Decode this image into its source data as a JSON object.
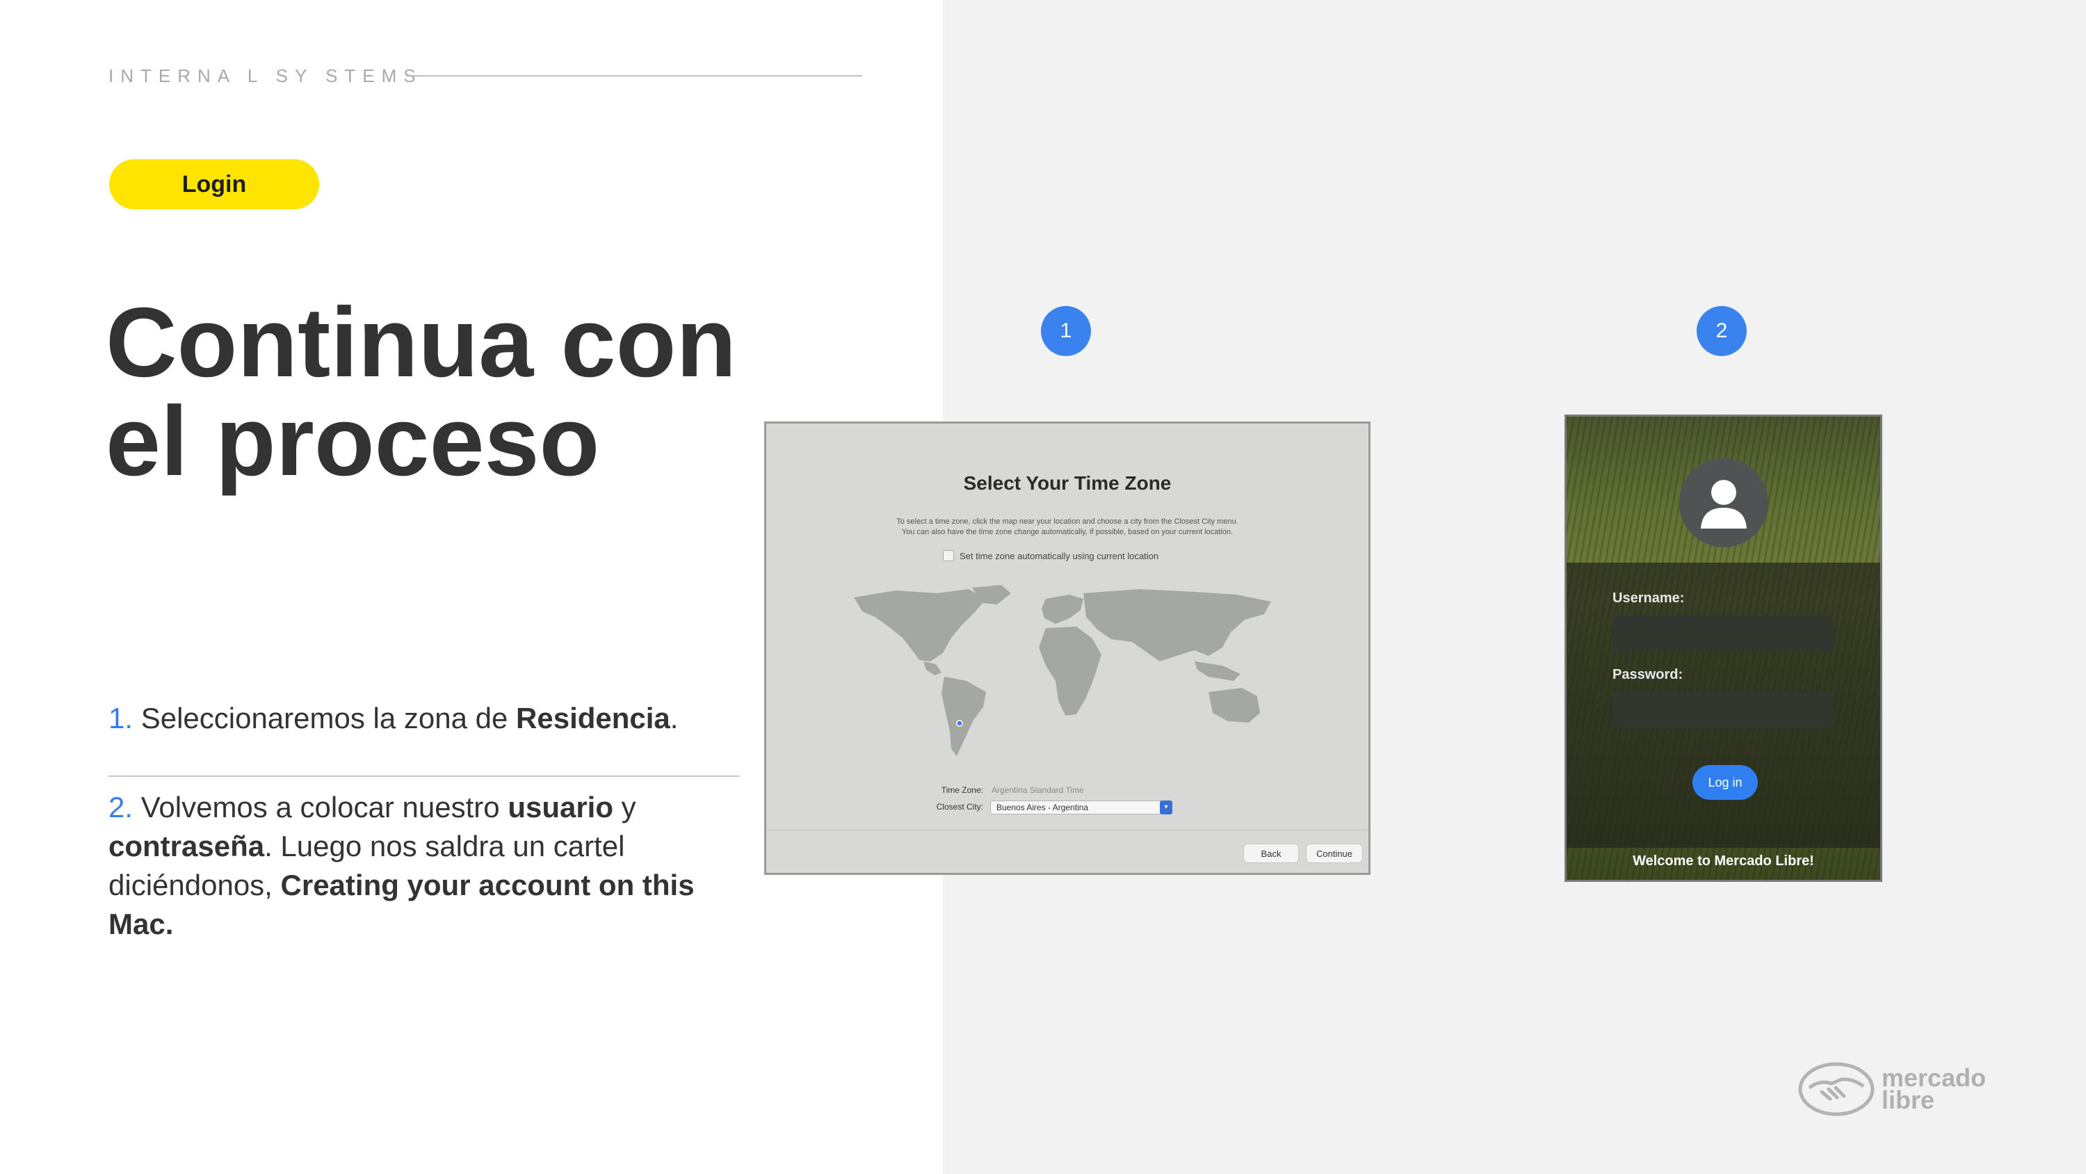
{
  "header": {
    "eyebrow": "INTERNA L SY STEMS",
    "section_pill": "Login"
  },
  "main": {
    "title_line1": "Continua con",
    "title_line2": "el proceso",
    "steps": [
      {
        "number": "1.",
        "text_before": " Seleccionaremos la zona de ",
        "bold": "Residencia",
        "text_after": "."
      },
      {
        "number": "2.",
        "text_1": " Volvemos a colocar nuestro ",
        "bold_1": "usuario",
        "text_2": " y ",
        "bold_2": "contraseña",
        "text_3": ". Luego nos saldra un cartel diciéndonos, ",
        "bold_3": "Creating your account on this Mac."
      }
    ]
  },
  "badges": [
    "1",
    "2"
  ],
  "screenshot1": {
    "title": "Select Your Time Zone",
    "description_line1": "To select a time zone, click the map near your location and choose a city from the Closest City menu.",
    "description_line2": "You can also have the time zone change automatically, if possible, based on your current location.",
    "checkbox_label": "Set time zone automatically using current location",
    "time_zone_label": "Time Zone:",
    "time_zone_value": "Argentina Standard Time",
    "closest_city_label": "Closest City:",
    "closest_city_value": "Buenos Aires - Argentina",
    "back_button": "Back",
    "continue_button": "Continue"
  },
  "screenshot2": {
    "username_label": "Username:",
    "password_label": "Password:",
    "login_button": "Log in",
    "welcome_text": "Welcome to Mercado Libre!"
  },
  "logo": {
    "line1": "mercado",
    "line2": "libre"
  },
  "colors": {
    "accent_yellow": "#fde500",
    "badge_blue": "#3a82ee",
    "step_number_blue": "#3a7de6"
  }
}
